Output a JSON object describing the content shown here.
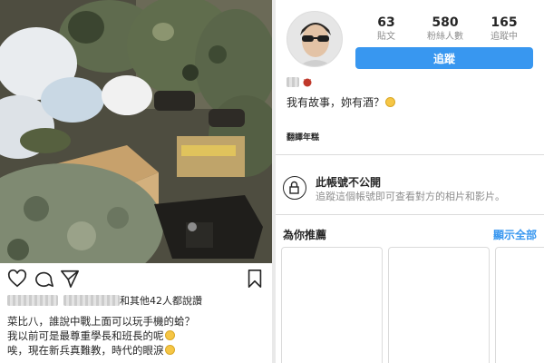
{
  "post": {
    "likes_suffix": "和其他42人都說讚",
    "caption_lines": [
      "菜比八，誰說中戰上面可以玩手機的蛤？",
      "我以前可是最尊重學長和班長的呢",
      "唉，現在新兵真難教，時代的眼淚"
    ]
  },
  "profile": {
    "stats": [
      {
        "num": "63",
        "label": "貼文"
      },
      {
        "num": "580",
        "label": "粉絲人數"
      },
      {
        "num": "165",
        "label": "追蹤中"
      }
    ],
    "follow_label": "追蹤",
    "bio": "我有故事，妳有酒？",
    "translate_label": "翻譯年糕",
    "private_title": "此帳號不公開",
    "private_desc": "追蹤這個帳號即可查看對方的相片和影片。",
    "recommend_title": "為你推薦",
    "recommend_all": "顯示全部"
  },
  "colors": {
    "accent": "#3897f0",
    "text": "#262626",
    "muted": "#8e8e8e",
    "border": "#dbdbdb"
  },
  "icons": {
    "actions": [
      "heart-icon",
      "comment-icon",
      "share-icon",
      "bookmark-icon"
    ],
    "private": "lock-icon"
  }
}
